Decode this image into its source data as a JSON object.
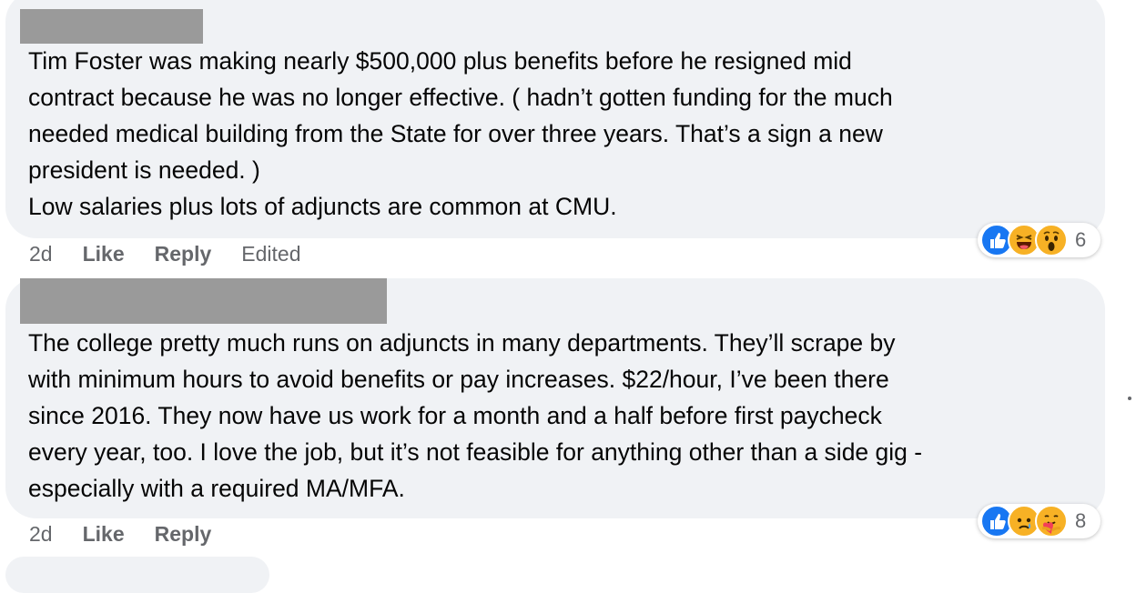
{
  "comments": [
    {
      "text": "Tim Foster was making nearly $500,000 plus benefits before he resigned mid\ncontract because he was no longer effective. ( hadn’t gotten funding for the much\nneeded medical building from the State for over three years. That’s a sign a new\npresident is needed. )\nLow salaries plus lots of adjuncts are common at CMU.",
      "age": "2d",
      "like_label": "Like",
      "reply_label": "Reply",
      "edited_label": "Edited",
      "reaction_icons": [
        "like-icon",
        "haha-icon",
        "wow-icon"
      ],
      "reaction_count": "6"
    },
    {
      "text": "The college pretty much runs on adjuncts in many departments. They’ll scrape by\nwith minimum hours to avoid benefits or pay increases. $22/hour, I’ve been there\nsince 2016. They now have us work for a month and a half before first paycheck\nevery year, too. I love the job, but it’s not feasible for anything other than a side gig -\nespecially with a required MA/MFA.",
      "age": "2d",
      "like_label": "Like",
      "reply_label": "Reply",
      "reaction_icons": [
        "like-icon",
        "sad-icon",
        "care-icon"
      ],
      "reaction_count": "8"
    }
  ],
  "colors": {
    "bubble": "#f0f2f5",
    "redaction": "#9a9a9a",
    "like_blue": "#1877f2",
    "emoji_yellow": "#f7b125",
    "meta_gray": "#65676b"
  }
}
